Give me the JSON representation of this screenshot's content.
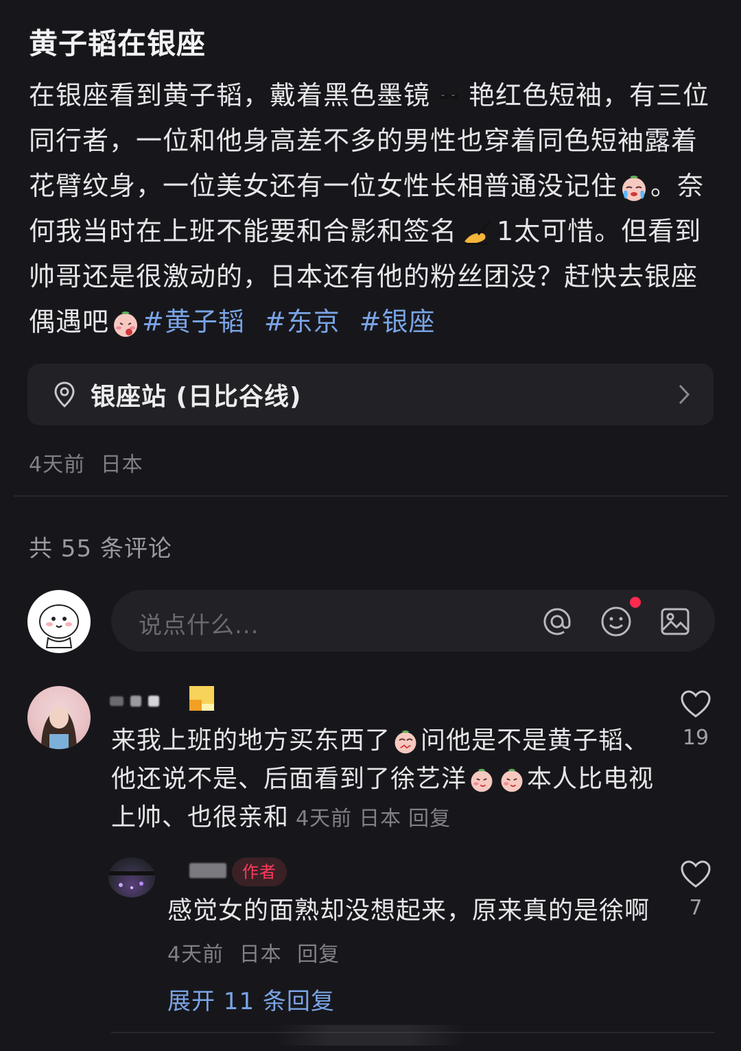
{
  "post": {
    "title": "黄子韬在银座",
    "body_segments": [
      "在银座看到黄子韬，戴着黑色墨镜",
      "艳红色短袖，有三位同行者，一位和他身高差不多的男性也穿着同色短袖露着花臂纹身，一位美女还有一位女性长相普通没记住",
      "。奈何我当时在上班不能要和合影和签名",
      "1太可惜。但看到帅哥还是很激动的，日本还有他的粉丝团没？赶快去银座偶遇吧"
    ],
    "tags": [
      "#黄子韬",
      "#东京",
      "#银座"
    ],
    "emojis": [
      "sunglasses-emoji",
      "crying-face-emoji",
      "writing-hand-emoji",
      "blushing-face-emoji"
    ]
  },
  "location": {
    "label": "银座站 (日比谷线)",
    "icon": "location-pin-icon"
  },
  "post_meta": {
    "time": "4天前",
    "region": "日本"
  },
  "comments_header": {
    "count_text": "共 55 条评论"
  },
  "comment_input": {
    "placeholder": "说点什么...",
    "icons": [
      "at-icon",
      "emoji-icon",
      "image-icon"
    ],
    "notification_color": "#ff2a4e"
  },
  "comments": [
    {
      "segments": [
        "来我上班的地方买东西了",
        "问他是不是黄子韬、他还说不是、后面看到了徐艺洋",
        "本人比电视上帅、也很亲和"
      ],
      "time": "4天前",
      "region": "日本",
      "reply_label": "回复",
      "likes": "19",
      "reply": {
        "badge": "作者",
        "text": "感觉女的面熟却没想起来，原来真的是徐啊",
        "time": "4天前",
        "region": "日本",
        "reply_label": "回复",
        "likes": "7"
      }
    }
  ],
  "expand_replies": {
    "label": "展开 11 条回复"
  },
  "colors": {
    "background": "#17171b",
    "card": "#222226",
    "link": "#7aa4e6",
    "meta_text": "#808086",
    "author_badge": "#ff3b5c"
  }
}
